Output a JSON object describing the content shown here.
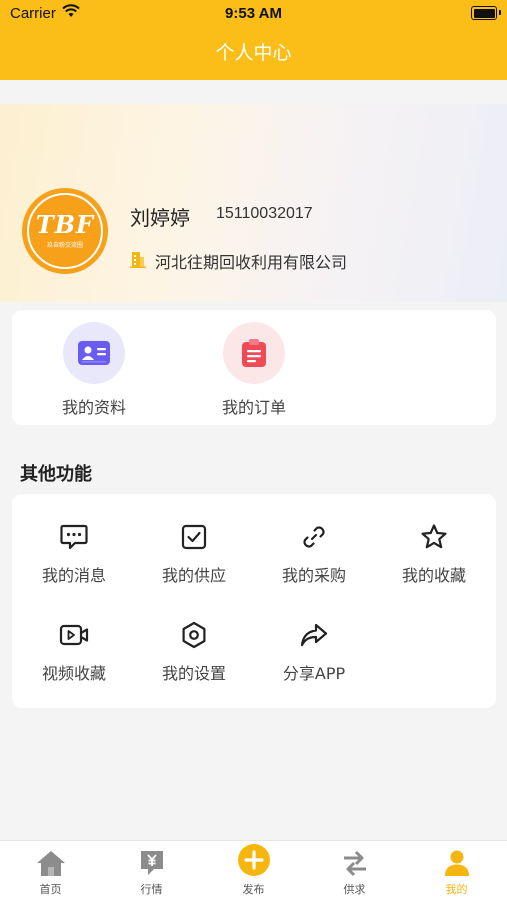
{
  "status_bar": {
    "carrier": "Carrier",
    "time": "9:53 AM"
  },
  "header": {
    "title": "个人中心"
  },
  "profile": {
    "avatar_logo": "TBF",
    "avatar_subtitle": "玖自粉交流圈",
    "name": "刘婷婷",
    "phone": "15110032017",
    "company": "河北往期回收利用有限公司"
  },
  "quick_actions": [
    {
      "label": "我的资料",
      "icon": "id-card-icon",
      "color": "#6b5cf0",
      "bg": "#e9e8fb"
    },
    {
      "label": "我的订单",
      "icon": "clipboard-icon",
      "color": "#ef4b57",
      "bg": "#fbe7e8"
    }
  ],
  "other_functions": {
    "title": "其他功能",
    "items": [
      {
        "label": "我的消息",
        "icon": "message-icon"
      },
      {
        "label": "我的供应",
        "icon": "checkbox-icon"
      },
      {
        "label": "我的采购",
        "icon": "link-icon"
      },
      {
        "label": "我的收藏",
        "icon": "star-icon"
      },
      {
        "label": "视频收藏",
        "icon": "video-icon"
      },
      {
        "label": "我的设置",
        "icon": "settings-icon"
      },
      {
        "label": "分享APP",
        "icon": "share-icon"
      }
    ]
  },
  "tabbar": {
    "active_color": "#f5b70f",
    "items": [
      {
        "label": "首页",
        "icon": "home-icon"
      },
      {
        "label": "行情",
        "icon": "price-icon"
      },
      {
        "label": "发布",
        "icon": "plus-icon"
      },
      {
        "label": "供求",
        "icon": "swap-icon"
      },
      {
        "label": "我的",
        "icon": "user-icon"
      }
    ],
    "active_index": 4
  }
}
